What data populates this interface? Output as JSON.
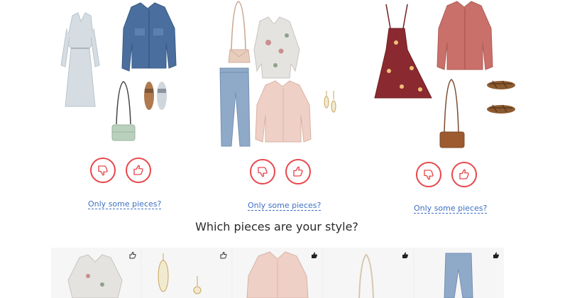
{
  "outfits": [
    {
      "name": "outfit-1",
      "items": [
        "grey-dress",
        "denim-jacket",
        "slide-sandals",
        "mint-crossbody-bag"
      ],
      "dislike_icon": "thumbs-down-icon",
      "like_icon": "thumbs-up-icon",
      "partial_link": "Only some pieces?"
    },
    {
      "name": "outfit-2",
      "items": [
        "blush-crossbody-bag",
        "floral-kimono",
        "light-wash-jeans",
        "pink-denim-jacket",
        "drop-earrings"
      ],
      "dislike_icon": "thumbs-down-icon",
      "like_icon": "thumbs-up-icon",
      "partial_link": "Only some pieces?"
    },
    {
      "name": "outfit-3",
      "items": [
        "burgundy-floral-dress",
        "rose-denim-jacket",
        "brown-crossbody-bag",
        "brown-sandals"
      ],
      "dislike_icon": "thumbs-down-icon",
      "like_icon": "thumbs-up-icon",
      "partial_link": "Only some pieces?"
    }
  ],
  "question": "Which pieces are your style?",
  "pieces": [
    {
      "item": "floral-kimono",
      "icon": "thumbs-up-outline-icon",
      "liked": false
    },
    {
      "item": "drop-earrings",
      "icon": "thumbs-up-outline-icon",
      "liked": false
    },
    {
      "item": "pink-denim-jacket",
      "icon": "thumbs-up-filled-icon",
      "liked": true
    },
    {
      "item": "crossbody-bag-strap",
      "icon": "thumbs-up-filled-icon",
      "liked": true
    },
    {
      "item": "light-wash-jeans",
      "icon": "thumbs-up-filled-icon",
      "liked": true
    }
  ],
  "colors": {
    "accent_red": "#e8474c",
    "link_blue": "#3d6fc4"
  }
}
